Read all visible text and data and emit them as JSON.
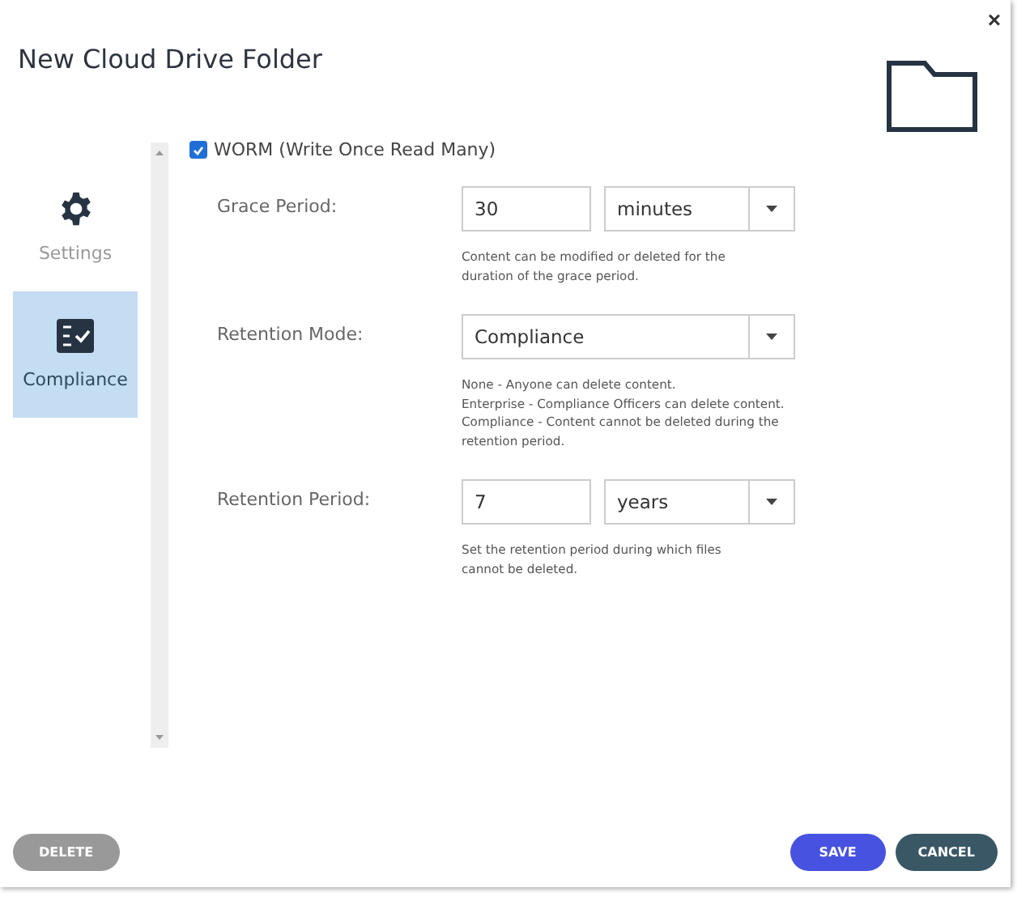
{
  "dialog": {
    "title": "New Cloud Drive Folder",
    "close": "×"
  },
  "sidebar": {
    "items": [
      {
        "label": "Settings",
        "kind": "gear",
        "selected": false
      },
      {
        "label": "Compliance",
        "kind": "checklist",
        "selected": true
      }
    ]
  },
  "worm": {
    "label": "WORM (Write Once Read Many)",
    "checked": true
  },
  "fields": [
    {
      "kind": "number_unit",
      "label": "Grace Period:",
      "value": "30",
      "unit": "minutes",
      "hint": [
        "Content can be modified or deleted for the",
        "duration of the grace period."
      ]
    },
    {
      "kind": "select",
      "label": "Retention Mode:",
      "value": "Compliance",
      "hint": [
        "None - Anyone can delete content.",
        "Enterprise - Compliance Officers can delete content.",
        "Compliance - Content cannot be deleted during the",
        "retention period."
      ]
    },
    {
      "kind": "number_unit",
      "label": "Retention Period:",
      "value": "7",
      "unit": "years",
      "hint": [
        "Set the retention period during which files",
        "cannot be deleted."
      ]
    }
  ],
  "buttons": [
    {
      "kind": "delete",
      "label": "DELETE"
    },
    {
      "kind": "save",
      "label": "SAVE"
    },
    {
      "kind": "cancel",
      "label": "CANCEL"
    }
  ]
}
